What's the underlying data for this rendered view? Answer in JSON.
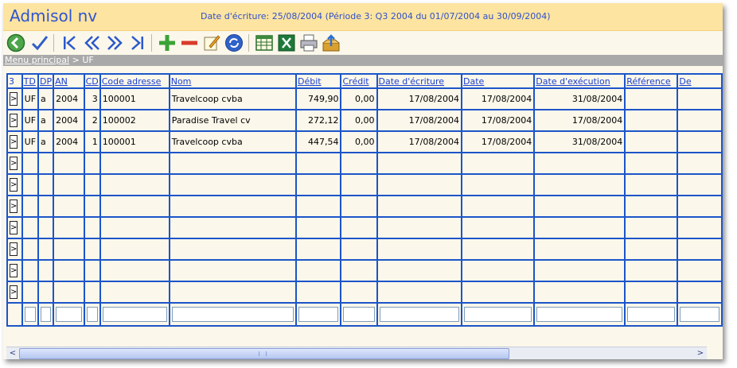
{
  "app": {
    "title": "Admisol nv",
    "period_text": "Date d'écriture: 25/08/2004 (Période 3: Q3 2004 du 01/07/2004 au 30/09/2004)"
  },
  "toolbar": {
    "buttons": [
      {
        "icon": "back-icon"
      },
      {
        "icon": "checkmark-icon"
      },
      {
        "icon": "first-record-icon"
      },
      {
        "icon": "previous-record-icon"
      },
      {
        "icon": "next-record-icon"
      },
      {
        "icon": "last-record-icon"
      },
      {
        "icon": "add-icon"
      },
      {
        "icon": "delete-icon"
      },
      {
        "icon": "edit-icon"
      },
      {
        "icon": "refresh-icon"
      },
      {
        "icon": "grid-view-icon"
      },
      {
        "icon": "excel-icon"
      },
      {
        "icon": "print-icon"
      },
      {
        "icon": "export-icon"
      }
    ]
  },
  "breadcrumb": {
    "root": "Menu principal",
    "separator": ">",
    "current": "UF"
  },
  "table": {
    "corner": "3",
    "columns": [
      "TD",
      "DP",
      "AN",
      "CD",
      "Code adresse",
      "Nom",
      "Débit",
      "Crédit",
      "Date d'écriture",
      "Date",
      "Date d'exécution",
      "Référence",
      "De"
    ],
    "rows": [
      {
        "btn": ">",
        "td": "UF",
        "dp": "a",
        "an": "2004",
        "cd": "3",
        "code": "100001",
        "nom": "Travelcoop cvba",
        "debit": "749,90",
        "credit": "0,00",
        "date_ecriture": "17/08/2004",
        "date": "17/08/2004",
        "date_execution": "31/08/2004",
        "reference": "",
        "de": ""
      },
      {
        "btn": ">",
        "td": "UF",
        "dp": "a",
        "an": "2004",
        "cd": "2",
        "code": "100002",
        "nom": "Paradise Travel cv",
        "debit": "272,12",
        "credit": "0,00",
        "date_ecriture": "17/08/2004",
        "date": "17/08/2004",
        "date_execution": "17/08/2004",
        "reference": "",
        "de": ""
      },
      {
        "btn": ">",
        "td": "UF",
        "dp": "a",
        "an": "2004",
        "cd": "1",
        "code": "100001",
        "nom": "Travelcoop cvba",
        "debit": "447,54",
        "credit": "0,00",
        "date_ecriture": "17/08/2004",
        "date": "17/08/2004",
        "date_execution": "31/08/2004",
        "reference": "",
        "de": ""
      }
    ],
    "empty_row_btn": ">",
    "selected_row": 0
  },
  "scrollbar": {
    "left_arrow": "<",
    "right_arrow": ">"
  },
  "colors": {
    "header_bg": "#fde4a0",
    "title": "#2e54d1",
    "grid_border": "#1d55c9",
    "selected_row": "#b5c4de",
    "background": "#fbf7ea"
  }
}
